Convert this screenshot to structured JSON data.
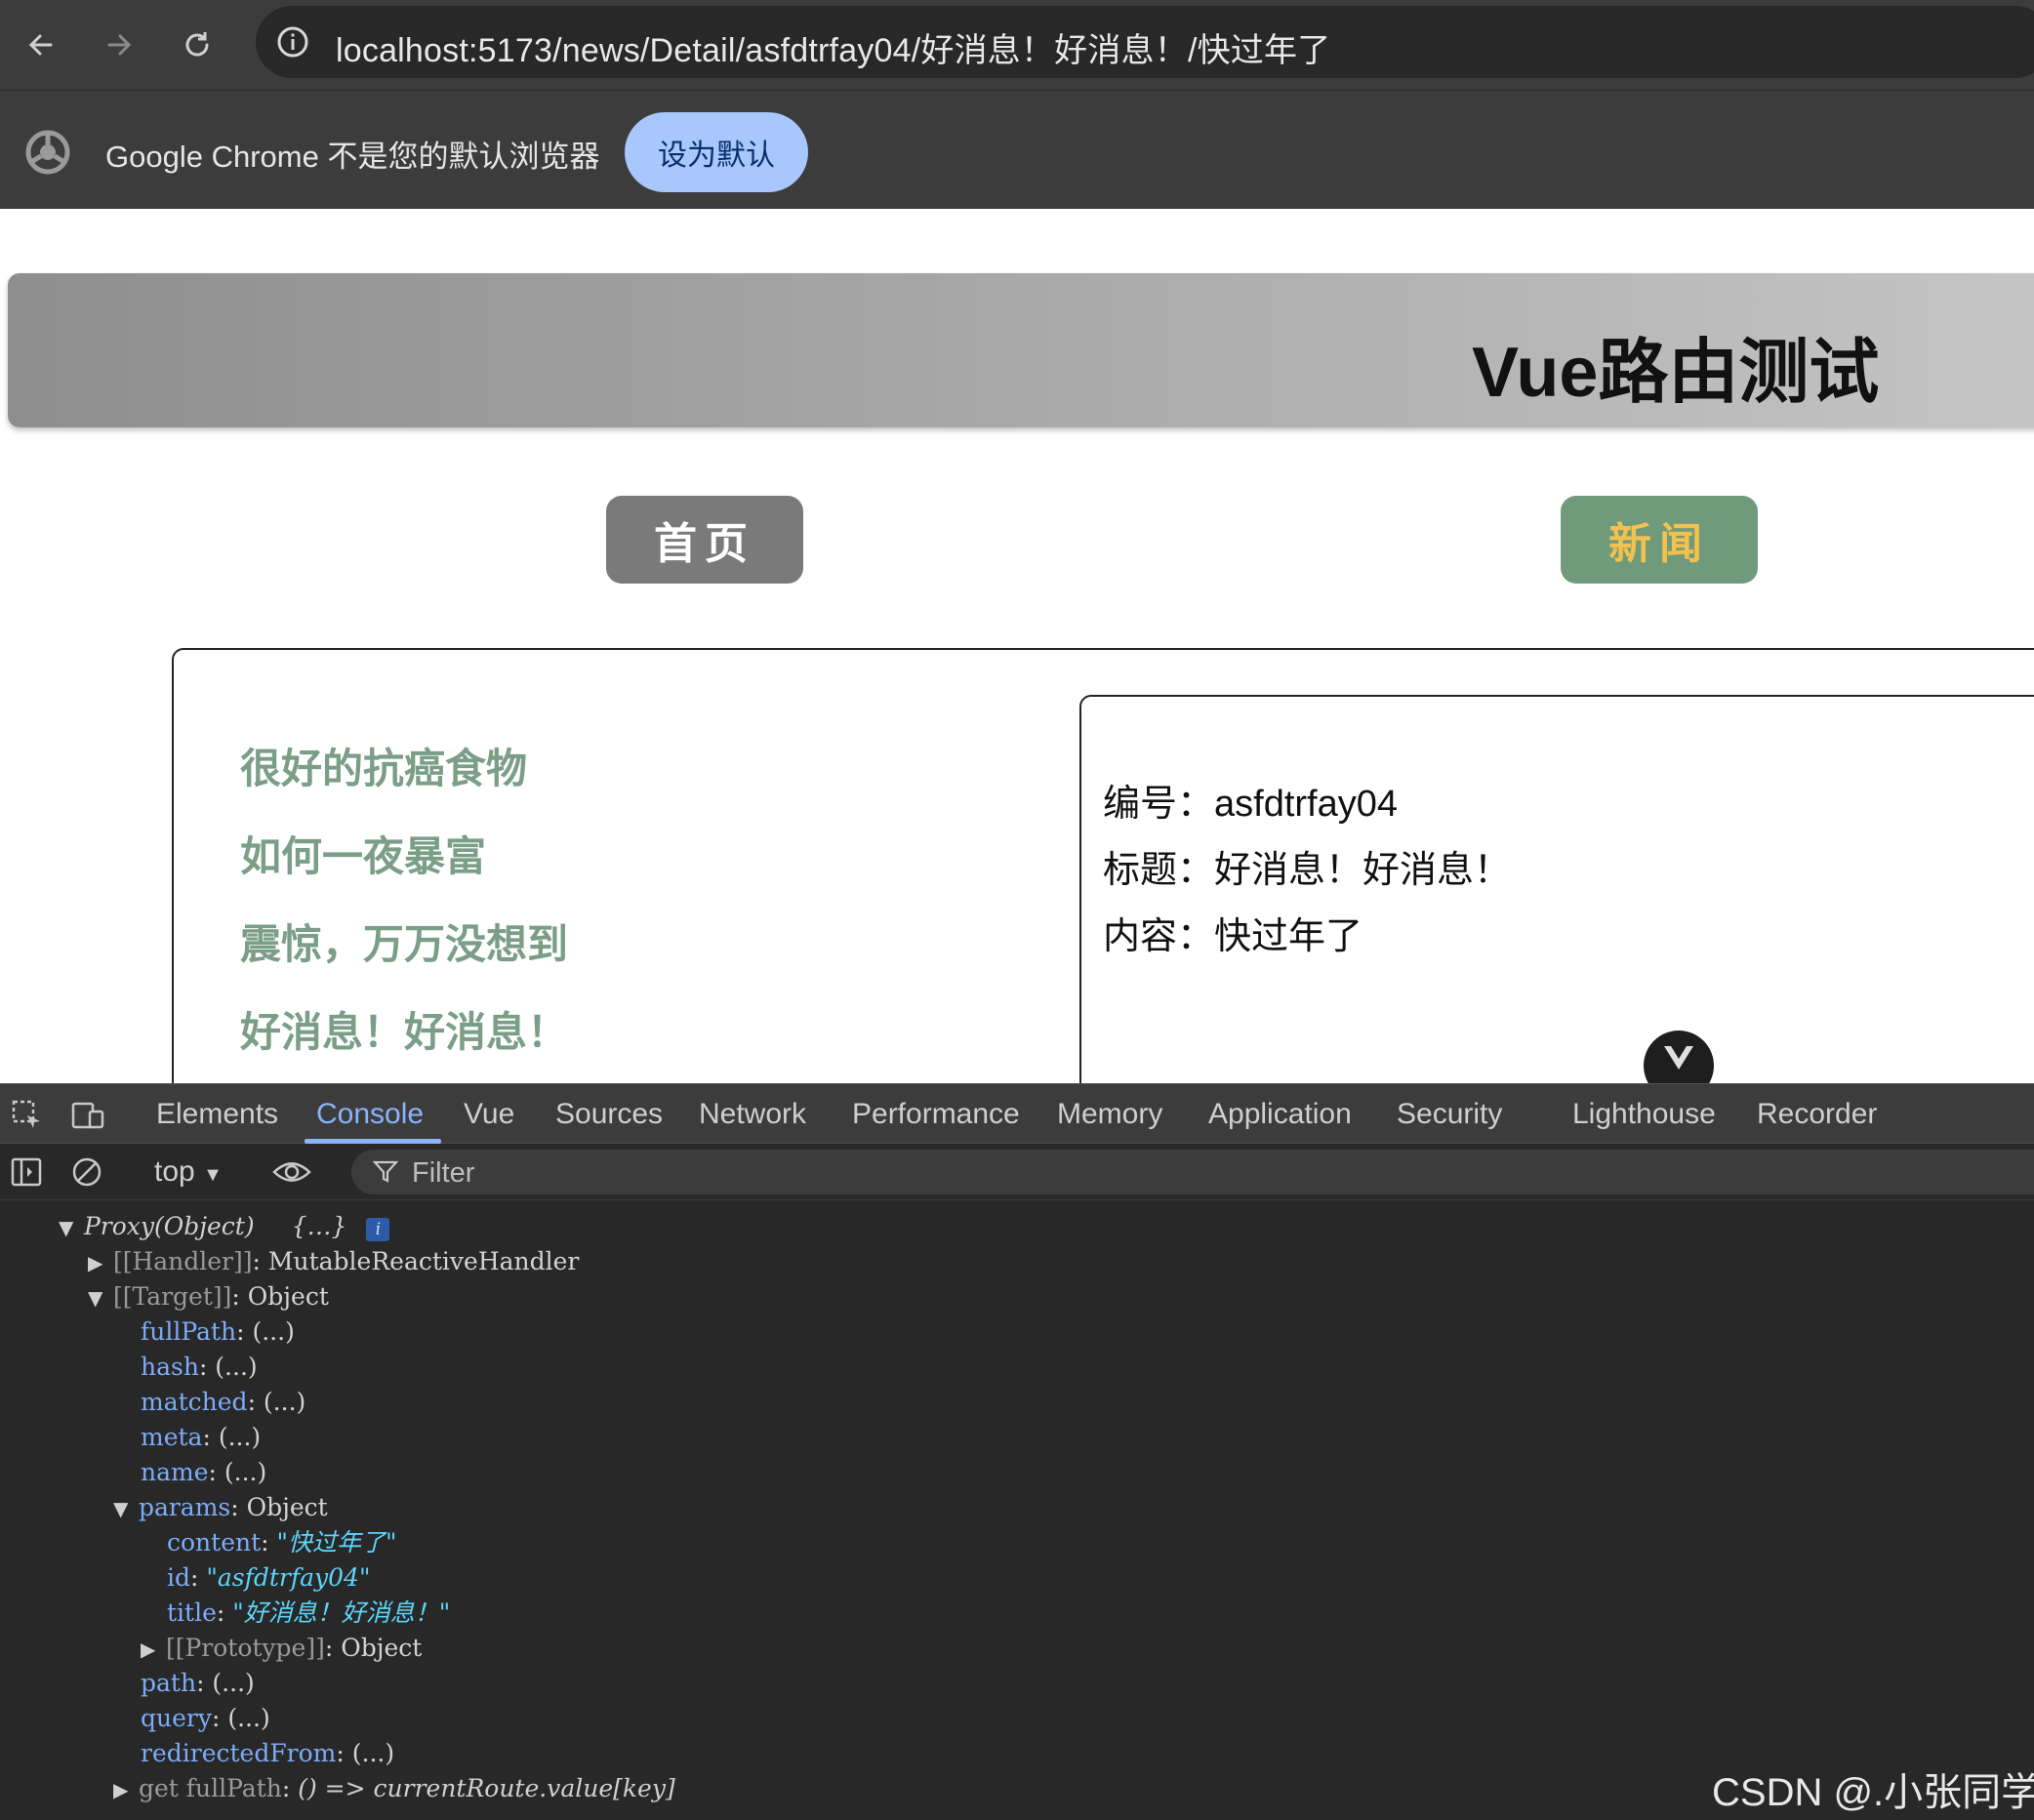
{
  "browser": {
    "url": "localhost:5173/news/Detail/asfdtrfay04/好消息！好消息！/快过年了",
    "infobar_text": "Google Chrome 不是您的默认浏览器",
    "set_default_label": "设为默认"
  },
  "page": {
    "header_title": "Vue路由测试",
    "nav": {
      "home": "首页",
      "news": "新闻"
    },
    "news_list": [
      "很好的抗癌食物",
      "如何一夜暴富",
      "震惊，万万没想到",
      "好消息！好消息！"
    ],
    "detail": {
      "id_row": "编号：asfdtrfay04",
      "title_row": "标题：好消息！好消息！",
      "content_row": "内容：快过年了"
    }
  },
  "devtools": {
    "tabs": [
      "Elements",
      "Console",
      "Vue",
      "Sources",
      "Network",
      "Performance",
      "Memory",
      "Application",
      "Security",
      "Lighthouse",
      "Recorder"
    ],
    "active_tab": "Console",
    "context": "top",
    "filter_placeholder": "Filter",
    "console": {
      "proxy_label": "Proxy(Object)",
      "proxy_preview": "{…}",
      "handler_key": "[[Handler]]",
      "handler_value": ": MutableReactiveHandler",
      "target_key": "[[Target]]",
      "target_value": ": Object",
      "props": [
        {
          "key": "fullPath",
          "value": ": (...)"
        },
        {
          "key": "hash",
          "value": ": (...)"
        },
        {
          "key": "matched",
          "value": ": (...)"
        },
        {
          "key": "meta",
          "value": ": (...)"
        },
        {
          "key": "name",
          "value": ": (...)"
        }
      ],
      "params_key": "params",
      "params_value": ": Object",
      "params": [
        {
          "key": "content",
          "value": "\"快过年了\""
        },
        {
          "key": "id",
          "value": "\"asfdtrfay04\""
        },
        {
          "key": "title",
          "value": "\"好消息！好消息！\""
        }
      ],
      "prototype_key": "[[Prototype]]",
      "prototype_value": ": Object",
      "props_after": [
        {
          "key": "path",
          "value": ": (...)"
        },
        {
          "key": "query",
          "value": ": (...)"
        },
        {
          "key": "redirectedFrom",
          "value": ": (...)"
        }
      ],
      "getter_key": "get fullPath",
      "getter_value": "() => currentRoute.value[key]"
    }
  },
  "watermark": "CSDN @.小张同学",
  "colors": {
    "chrome_bg": "#3c3c3c",
    "default_btn": "#a8c7fa",
    "nav_home_bg": "#7a7a7a",
    "nav_news_bg": "#6f9a7c",
    "nav_news_text": "#f2c14e",
    "news_link": "#7a9e86",
    "devtools_active": "#8ab4f8"
  }
}
